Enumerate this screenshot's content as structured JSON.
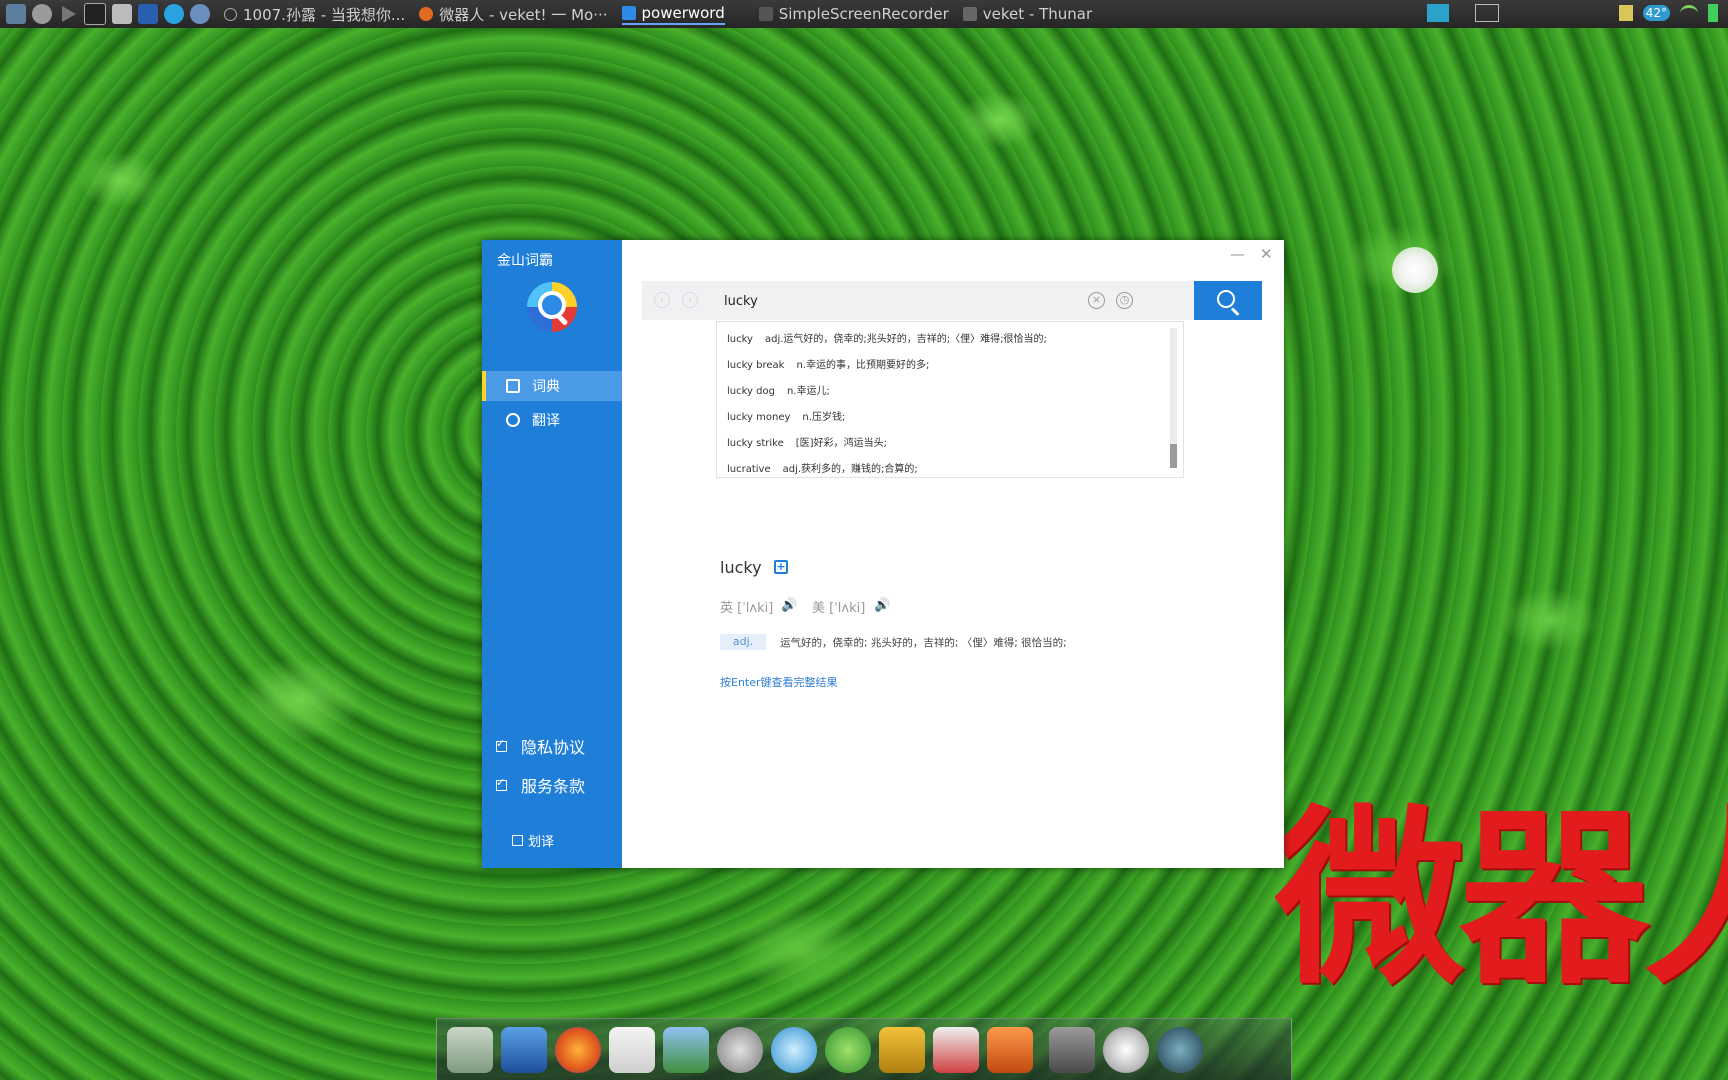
{
  "taskbar": {
    "tasks": [
      {
        "label": "1007.孙露 - 当我想你...",
        "active": false
      },
      {
        "label": "微器人 - veket! 一 Mo···",
        "active": false
      },
      {
        "label": "powerword",
        "active": true
      },
      {
        "label": "SimpleScreenRecorder",
        "active": false
      },
      {
        "label": "veket - Thunar",
        "active": false
      }
    ],
    "temperature": "42°"
  },
  "desktop": {
    "watermark": "微器人"
  },
  "app": {
    "title": "金山词霸",
    "nav": [
      {
        "label": "词典",
        "icon": "dictionary-icon",
        "active": true
      },
      {
        "label": "翻译",
        "icon": "translate-icon",
        "active": false
      }
    ],
    "checks": [
      {
        "label": "隐私协议",
        "checked": true
      },
      {
        "label": "服务条款",
        "checked": true
      }
    ],
    "hover_translate": {
      "label": "划译",
      "checked": false
    },
    "controls": {
      "minimize": "—",
      "close": "✕"
    },
    "search": {
      "value": "lucky",
      "back": "‹",
      "forward": "›",
      "clear": "×",
      "history": "◷"
    },
    "suggestions": [
      {
        "word": "lucky",
        "meaning": "adj.运气好的，侥幸的;兆头好的，吉祥的;〈俚〉难得;很恰当的;"
      },
      {
        "word": "lucky break",
        "meaning": "n.幸运的事，比预期要好的多;"
      },
      {
        "word": "lucky dog",
        "meaning": "n.幸运儿;"
      },
      {
        "word": "lucky money",
        "meaning": "n.压岁钱;"
      },
      {
        "word": "lucky strike",
        "meaning": "[医]好彩，鸿运当头;"
      },
      {
        "word": "lucrative",
        "meaning": "adj.获利多的，赚钱的;合算的;"
      }
    ],
    "result": {
      "word": "lucky",
      "uk_phonetic": "英 [ˈlʌki]",
      "us_phonetic": "美 [ˈlʌki]",
      "pos": "adj.",
      "definition": "运气好的，侥幸的; 兆头好的，吉祥的; 〈俚〉难得; 很恰当的;",
      "more_hint": "按Enter键查看完整结果"
    }
  },
  "colors": {
    "accent": "#1f7fd8",
    "highlight": "#ffd22e",
    "watermark": "#e21c1c"
  }
}
